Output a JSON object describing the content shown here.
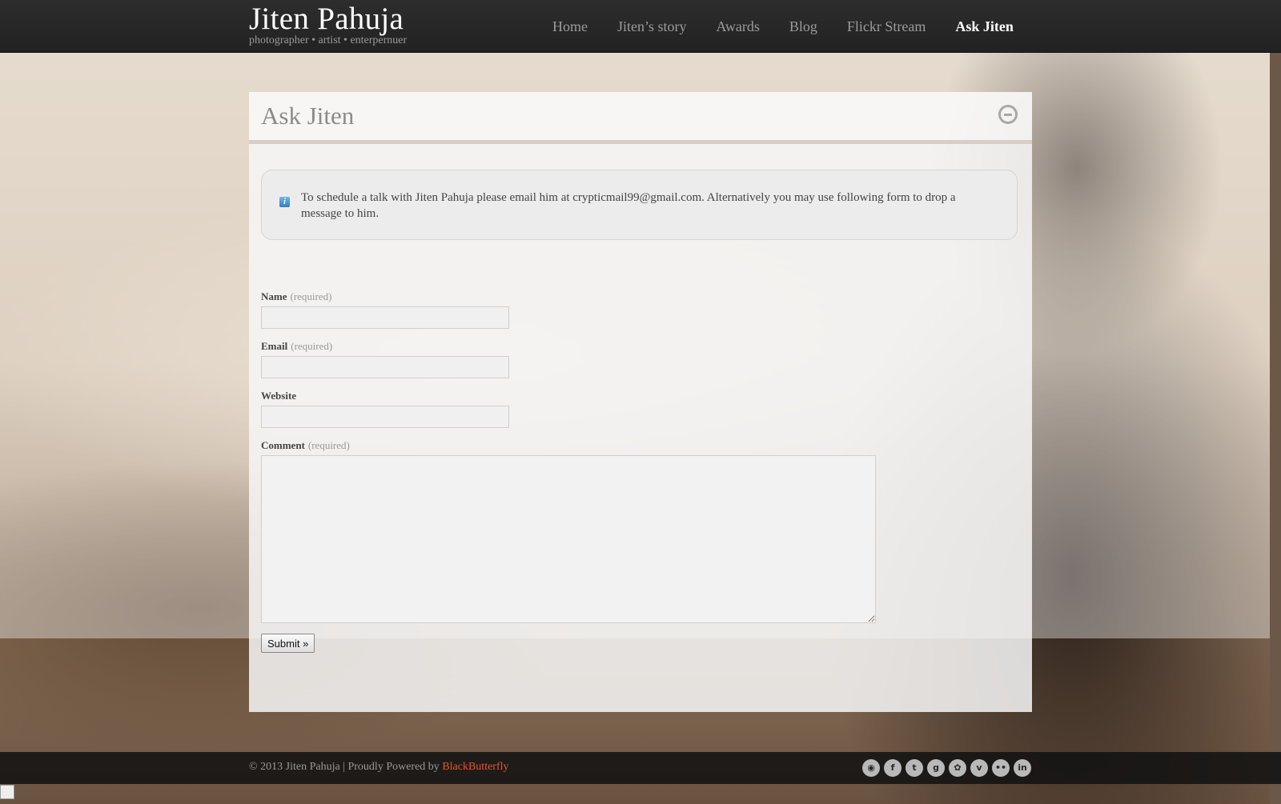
{
  "site": {
    "title": "Jiten Pahuja",
    "tagline": "photographer • artist • enterpernuer"
  },
  "nav": [
    {
      "label": "Home"
    },
    {
      "label": "Jiten’s story"
    },
    {
      "label": "Awards"
    },
    {
      "label": "Blog"
    },
    {
      "label": "Flickr Stream"
    },
    {
      "label": "Ask Jiten",
      "active": true
    }
  ],
  "page": {
    "title": "Ask Jiten",
    "info_text": "To schedule a talk with Jiten Pahuja please email him at crypticmail99@gmail.com. Alternatively you may use following form to drop a message to him."
  },
  "form": {
    "name_label": "Name",
    "email_label": "Email",
    "website_label": "Website",
    "comment_label": "Comment",
    "required_text": "(required)",
    "name_value": "",
    "email_value": "",
    "website_value": "",
    "comment_value": "",
    "submit_label": "Submit »"
  },
  "footer": {
    "copyright": "© 2013 Jiten Pahuja | Proudly Powered by ",
    "powered_link": "BlackButterfly",
    "social_icons": [
      "rss-icon",
      "facebook-icon",
      "twitter-icon",
      "google-plus-icon",
      "picasa-icon",
      "vimeo-icon",
      "flickr-icon",
      "linkedin-icon"
    ]
  },
  "colors": {
    "topbar": "#262626",
    "accent_link": "#e8572a",
    "nav_active": "#ffffff",
    "nav_inactive": "#9c9c9c"
  }
}
